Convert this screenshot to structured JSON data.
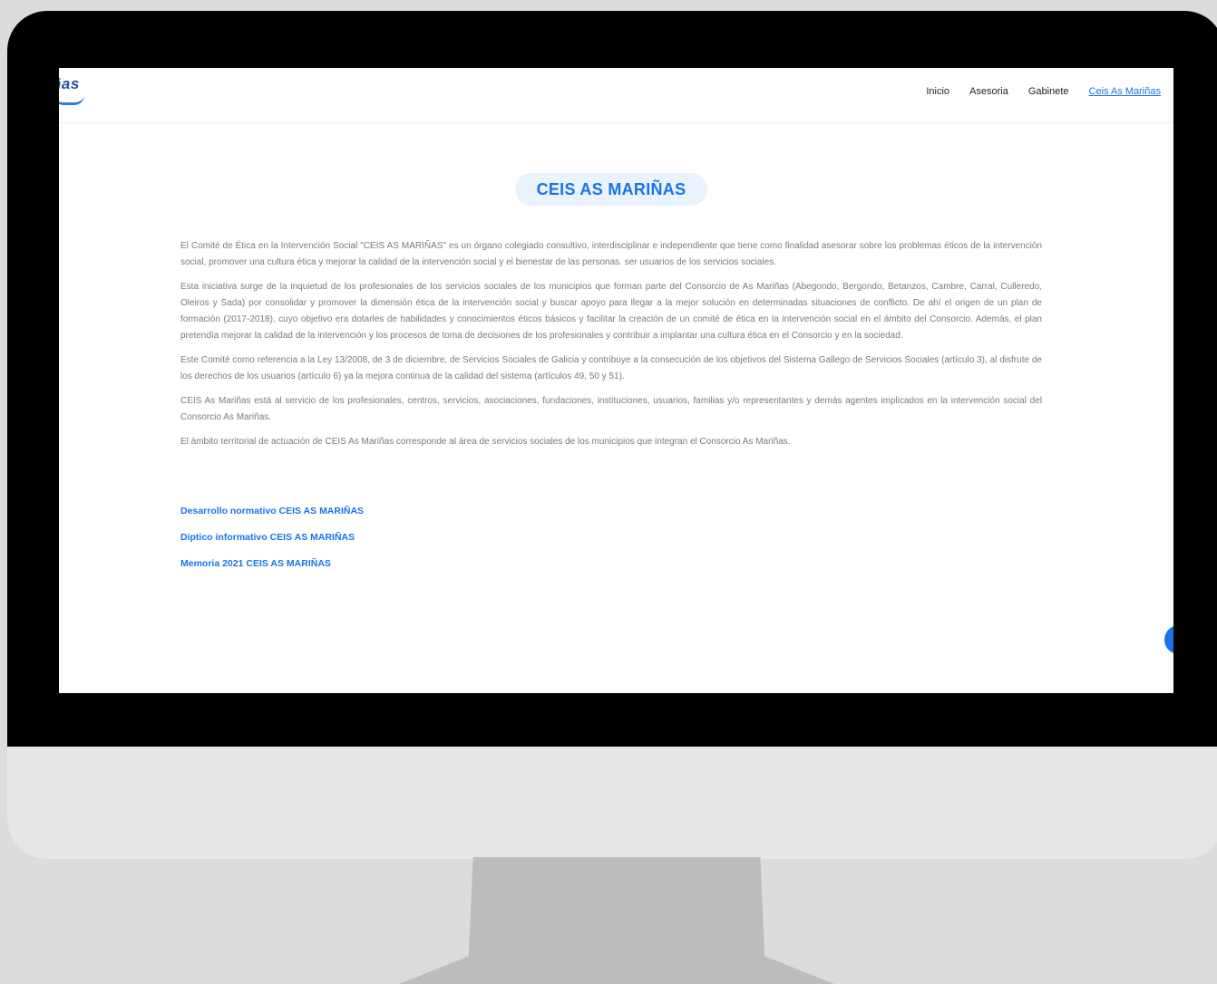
{
  "header": {
    "logo_text": "ñas",
    "nav": [
      "Inicio",
      "Asesoria",
      "Gabinete",
      "Ceis As Mariñas"
    ],
    "active_index": 3
  },
  "main": {
    "title": "CEIS AS MARIÑAS",
    "paragraphs": [
      "El Comité de Ética en la Intervención Social \"CEIS AS MARIÑAS\" es un órgano colegiado consultivo, interdisciplinar e independiente que tiene como finalidad asesorar sobre los problemas éticos de la intervención social, promover una cultura ética y mejorar la calidad de la intervención social y el bienestar de las personas. ser usuarios de los servicios sociales.",
      "Esta iniciativa surge de la inquietud de los profesionales de los servicios sociales de los municipios que forman parte del Consorcio de As Mariñas (Abegondo, Bergondo, Betanzos, Cambre, Carral, Culleredo, Oleiros y Sada) por consolidar y promover la dimensión ética de la intervención social y buscar apoyo para llegar a la mejor solución en determinadas situaciones de conflicto. De ahí el origen de un plan de formación (2017-2018), cuyo objetivo era dotarles de habilidades y conocimientos éticos básicos y facilitar la creación de un comité de ética en la intervención social en el ámbito del Consorcio. Además, el plan pretendía mejorar la calidad de la intervención y los procesos de toma de decisiones de los profesionales y contribuir a implantar una cultura ética en el Consorcio y en la sociedad.",
      "Este Comité como referencia a la Ley 13/2008, de 3 de diciembre, de Servicios Sociales de Galicia y contribuye a la consecución de los objetivos del Sistema Gallego de Servicios Sociales (artículo 3), al disfrute de los derechos de los usuarios (artículo 6) ya la mejora continua de la calidad del sistema (artículos 49, 50 y 51).",
      "CEIS As Mariñas está al servicio de los profesionales, centros, servicios, asociaciones, fundaciones, instituciones, usuarios, familias y/o representantes y demás agentes implicados en la intervención social del Consorcio As Mariñas.",
      "El ámbito territorial de actuación de CEIS As Mariñas corresponde al área de servicios sociales de los municipios que integran el Consorcio As Mariñas."
    ],
    "links": [
      "Desarrollo normativo CEIS AS MARIÑAS",
      "Diptico informativo CEIS AS MARIÑAS",
      "Memoria  2021 CEIS AS MARIÑAS"
    ]
  },
  "colors": {
    "accent": "#1a73e8",
    "text": "#7a7a7a",
    "pill_bg": "#eaf2fc"
  }
}
